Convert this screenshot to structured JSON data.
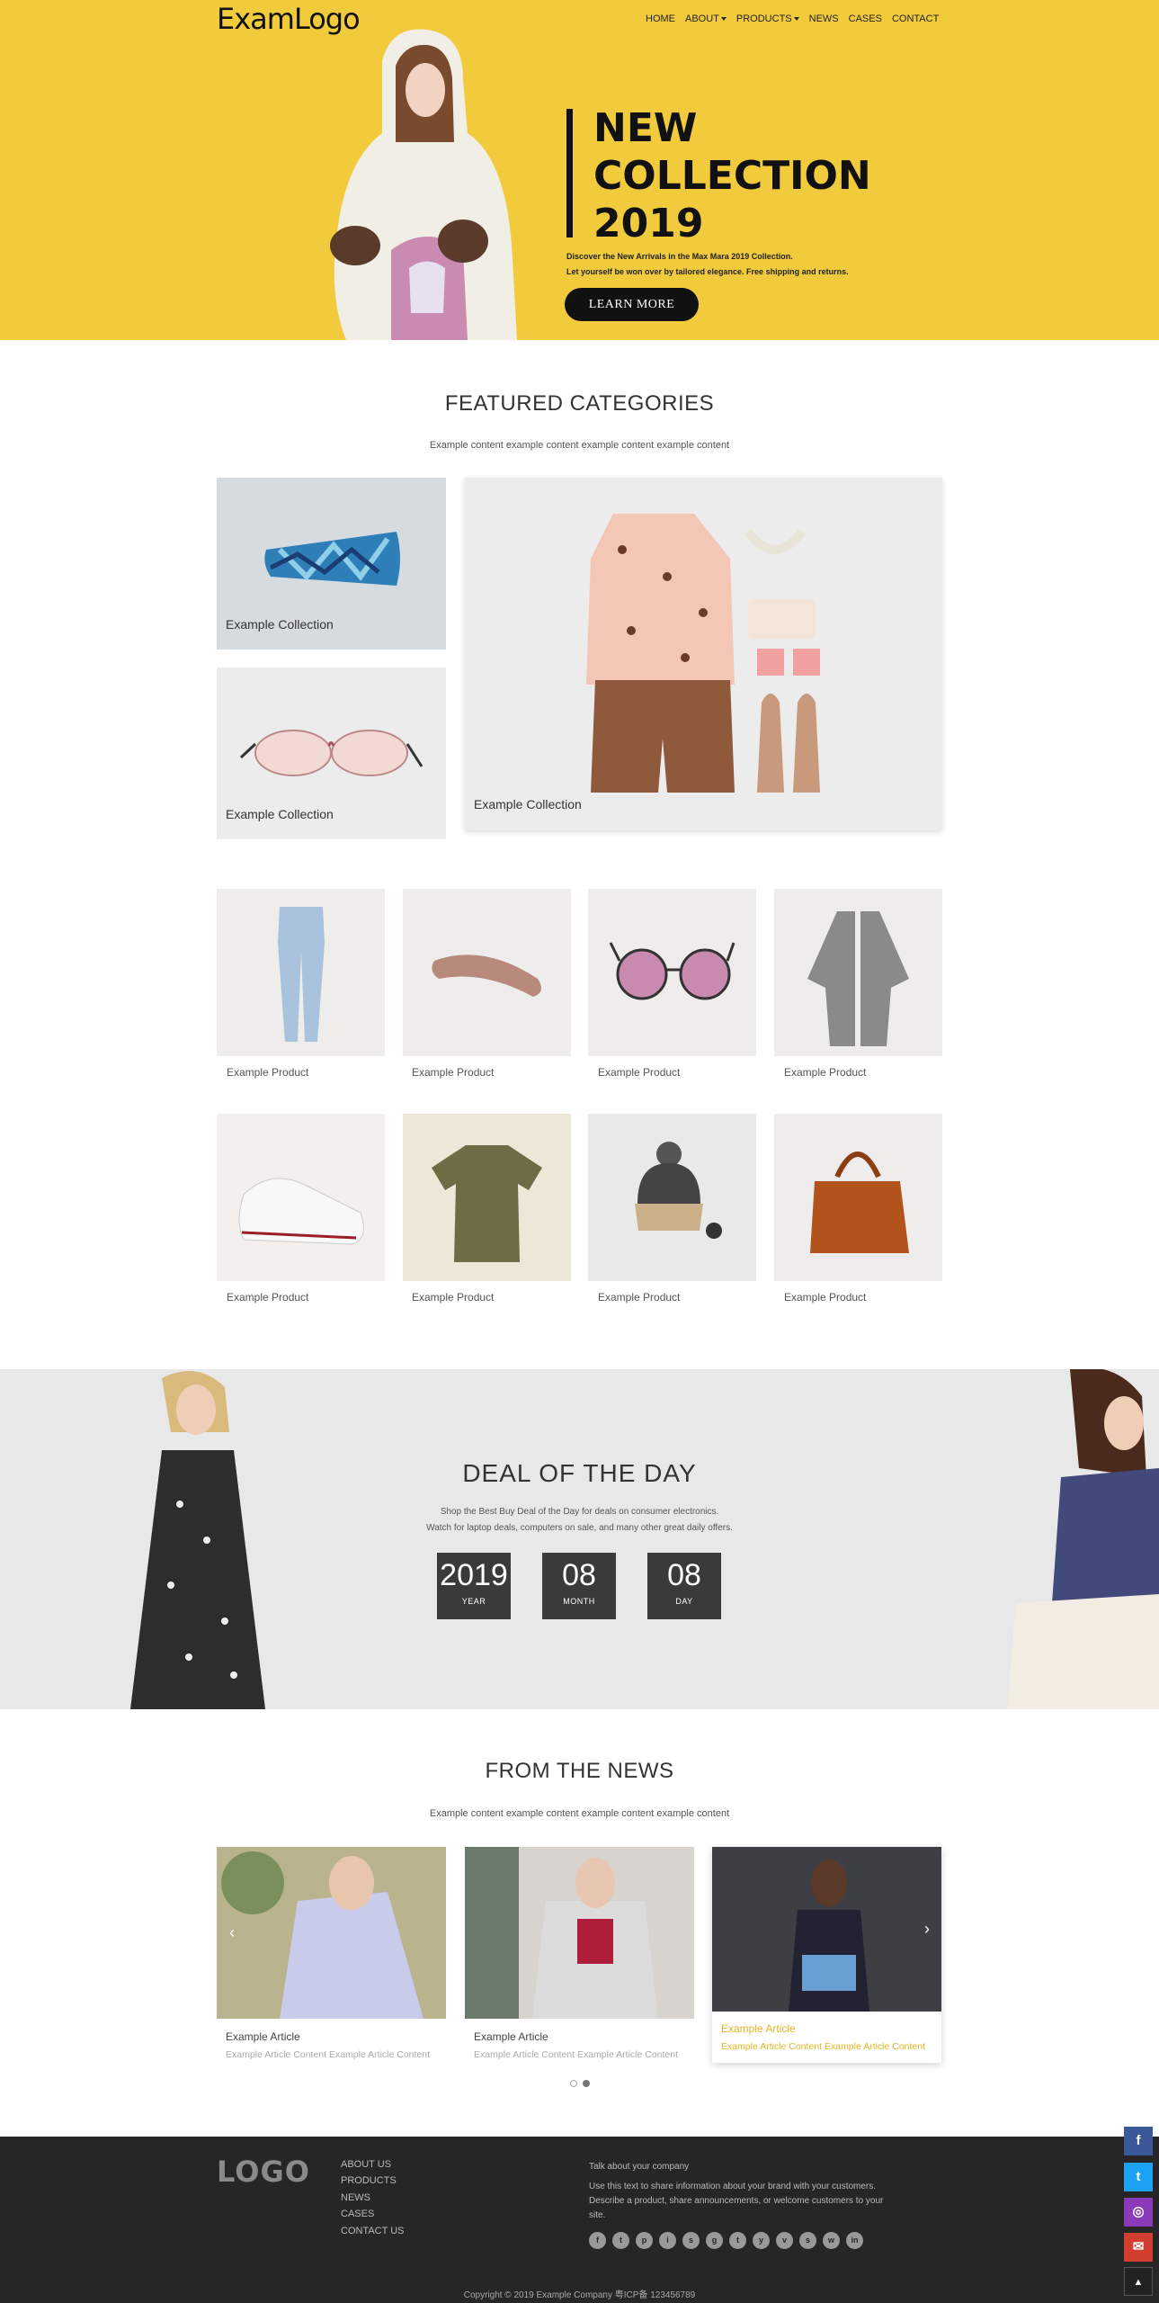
{
  "header": {
    "logo": "ExamLogo",
    "nav": [
      "HOME",
      "ABOUT",
      "PRODUCTS",
      "NEWS",
      "CASES",
      "CONTACT"
    ]
  },
  "hero": {
    "title_lines": [
      "NEW",
      "COLLECTION",
      "2019"
    ],
    "desc_line1": "Discover the New Arrivals in the Max Mara 2019 Collection.",
    "desc_line2": "Let yourself be won over by tailored elegance. Free shipping and returns.",
    "button": "LEARN MORE"
  },
  "featured": {
    "title": "FEATURED CATEGORIES",
    "subtitle": "Example content example content example content example content",
    "categories": [
      "Example Collection",
      "Example Collection",
      "Example Collection"
    ]
  },
  "products": [
    {
      "label": "Example Product",
      "icon": "jeans-icon"
    },
    {
      "label": "Example Product",
      "icon": "headband-icon"
    },
    {
      "label": "Example Product",
      "icon": "sunglasses-icon"
    },
    {
      "label": "Example Product",
      "icon": "cardigan-icon"
    },
    {
      "label": "Example Product",
      "icon": "sneaker-icon"
    },
    {
      "label": "Example Product",
      "icon": "tshirt-icon"
    },
    {
      "label": "Example Product",
      "icon": "beanie-icon"
    },
    {
      "label": "Example Product",
      "icon": "handbag-icon"
    }
  ],
  "deal": {
    "title": "DEAL OF THE DAY",
    "line1": "Shop the Best Buy Deal of the Day for deals on consumer electronics.",
    "line2": "Watch for laptop deals, computers on sale, and many other great daily offers.",
    "countdown": [
      {
        "num": "2019",
        "label": "YEAR"
      },
      {
        "num": "08",
        "label": "MONTH"
      },
      {
        "num": "08",
        "label": "DAY"
      }
    ]
  },
  "news": {
    "title": "FROM THE NEWS",
    "subtitle": "Example content example content example content example content",
    "articles": [
      {
        "title": "Example Article",
        "text": "Example Article Content Example Article Content"
      },
      {
        "title": "Example Article",
        "text": "Example Article Content Example Article Content"
      },
      {
        "title": "Example Article",
        "text": "Example Article Content Example Article Content"
      }
    ],
    "active_dot": 1
  },
  "footer": {
    "logo": "LOGO",
    "links": [
      "ABOUT US",
      "PRODUCTS",
      "NEWS",
      "CASES",
      "CONTACT US"
    ],
    "talk": "Talk about your company",
    "desc": "Use this text to share information about your brand with your customers. Describe a product, share announcements, or welcome customers to your site.",
    "social": [
      "f",
      "t",
      "p",
      "i",
      "s",
      "g",
      "t",
      "y",
      "v",
      "s",
      "w",
      "in"
    ],
    "copyright": "Copyright © 2019 Example Company    粤ICP备 123456789"
  },
  "side_buttons": [
    {
      "icon": "facebook-icon",
      "color": "#3b5998",
      "glyph": "f"
    },
    {
      "icon": "twitter-icon",
      "color": "#1da1f2",
      "glyph": "t"
    },
    {
      "icon": "instagram-icon",
      "color": "#8a3ab9",
      "glyph": "◎"
    },
    {
      "icon": "email-icon",
      "color": "#d23f31",
      "glyph": "✉"
    },
    {
      "icon": "back-to-top-icon",
      "color": "#222222",
      "glyph": "▲"
    }
  ],
  "colors": {
    "hero_bg": "#f2cb3c",
    "accent": "#e6b422",
    "footer_bg": "#262626"
  }
}
